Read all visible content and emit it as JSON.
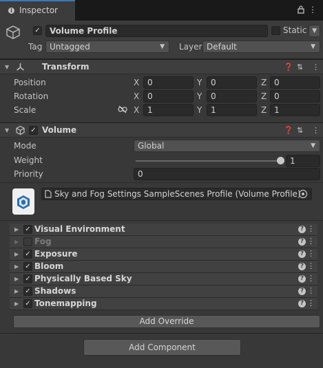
{
  "window": {
    "tab_label": "Inspector"
  },
  "header": {
    "object_name": "Volume Profile",
    "static_label": "Static",
    "tag_label": "Tag",
    "tag_value": "Untagged",
    "layer_label": "Layer",
    "layer_value": "Default"
  },
  "transform": {
    "title": "Transform",
    "rows": [
      {
        "label": "Position",
        "x": "0",
        "y": "0",
        "z": "0"
      },
      {
        "label": "Rotation",
        "x": "0",
        "y": "0",
        "z": "0"
      },
      {
        "label": "Scale",
        "x": "1",
        "y": "1",
        "z": "1"
      }
    ],
    "axes": {
      "x": "X",
      "y": "Y",
      "z": "Z"
    }
  },
  "volume": {
    "title": "Volume",
    "mode_label": "Mode",
    "mode_value": "Global",
    "weight_label": "Weight",
    "weight_value": "1",
    "weight_level": 1.0,
    "priority_label": "Priority",
    "priority_value": "0",
    "profile_value": "Sky and Fog Settings SampleScenes Profile (Volume Profile)"
  },
  "overrides": [
    {
      "name": "Visual Environment",
      "checked": true,
      "enabled": true
    },
    {
      "name": "Fog",
      "checked": false,
      "enabled": false
    },
    {
      "name": "Exposure",
      "checked": true,
      "enabled": true
    },
    {
      "name": "Bloom",
      "checked": true,
      "enabled": true
    },
    {
      "name": "Physically Based Sky",
      "checked": true,
      "enabled": true
    },
    {
      "name": "Shadows",
      "checked": true,
      "enabled": true
    },
    {
      "name": "Tonemapping",
      "checked": true,
      "enabled": true
    }
  ],
  "buttons": {
    "add_override": "Add Override",
    "add_component": "Add Component"
  },
  "colors": {
    "accent": "#3a79bb",
    "panel": "#383838",
    "field": "#2a2a2a"
  },
  "icons": {
    "tab": "info-icon",
    "lock": "lock-icon",
    "menu": "kebab-menu-icon",
    "help": "help-icon",
    "preset": "preset-icon",
    "link": "constrain-proportions-icon",
    "picker": "object-picker-icon"
  }
}
